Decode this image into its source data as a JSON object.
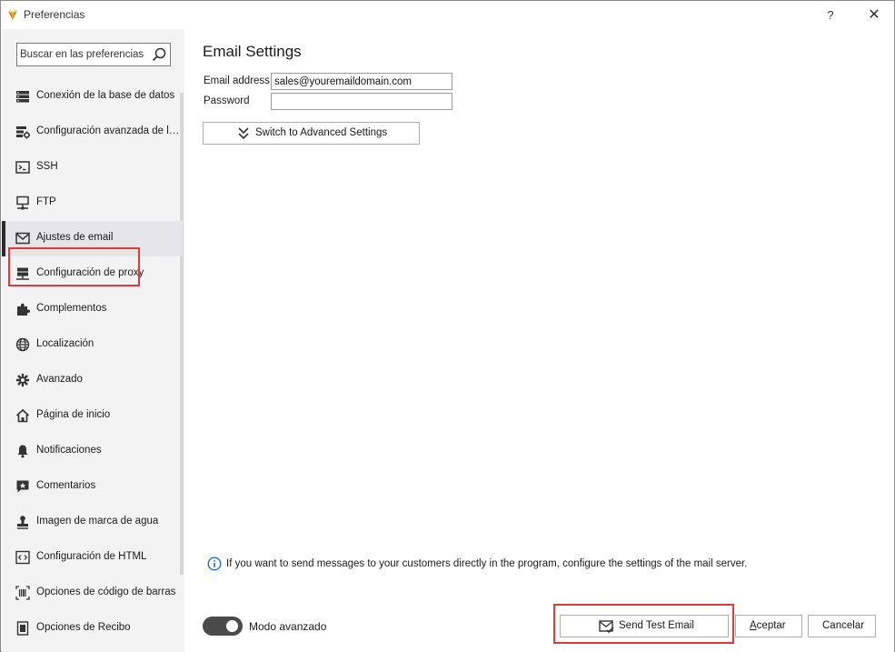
{
  "window": {
    "title": "Preferencias",
    "help_label": "?",
    "close_label": "✕"
  },
  "sidebar": {
    "search_placeholder": "Buscar en las preferencias",
    "items": [
      {
        "label": "Conexión de la base de datos",
        "icon": "database-icon"
      },
      {
        "label": "Configuración avanzada de la …",
        "icon": "database-settings-icon"
      },
      {
        "label": "SSH",
        "icon": "terminal-icon"
      },
      {
        "label": "FTP",
        "icon": "ftp-icon"
      },
      {
        "label": "Ajustes de email",
        "icon": "envelope-icon",
        "active": true
      },
      {
        "label": "Configuración de proxy",
        "icon": "proxy-server-icon"
      },
      {
        "label": "Complementos",
        "icon": "puzzle-icon"
      },
      {
        "label": "Localización",
        "icon": "globe-icon"
      },
      {
        "label": "Avanzado",
        "icon": "gear-icon"
      },
      {
        "label": "Página de inicio",
        "icon": "home-icon"
      },
      {
        "label": "Notificaciones",
        "icon": "bell-icon"
      },
      {
        "label": "Comentarios",
        "icon": "comment-star-icon"
      },
      {
        "label": "Imagen de marca de agua",
        "icon": "stamp-icon"
      },
      {
        "label": "Configuración de HTML",
        "icon": "code-icon"
      },
      {
        "label": "Opciones de código de barras",
        "icon": "barcode-icon"
      },
      {
        "label": "Opciones de Recibo",
        "icon": "receipt-icon"
      }
    ]
  },
  "main": {
    "title": "Email Settings",
    "email_label": "Email address",
    "email_value": "sales@youremaildomain.com",
    "password_label": "Password",
    "password_value": "",
    "advanced_button": "Switch to Advanced Settings",
    "info_text": "If you want to send messages to your customers directly in the program, configure the settings of the mail server."
  },
  "footer": {
    "toggle_label": "Modo avanzado",
    "toggle_on": true,
    "send_test": "Send Test Email",
    "accept_prefix": "A",
    "accept_rest": "ceptar",
    "cancel": "Cancelar"
  },
  "colors": {
    "highlight": "#e0393e",
    "sidebar_bg": "#f3f3f3",
    "toggle": "#4a4a4a"
  }
}
